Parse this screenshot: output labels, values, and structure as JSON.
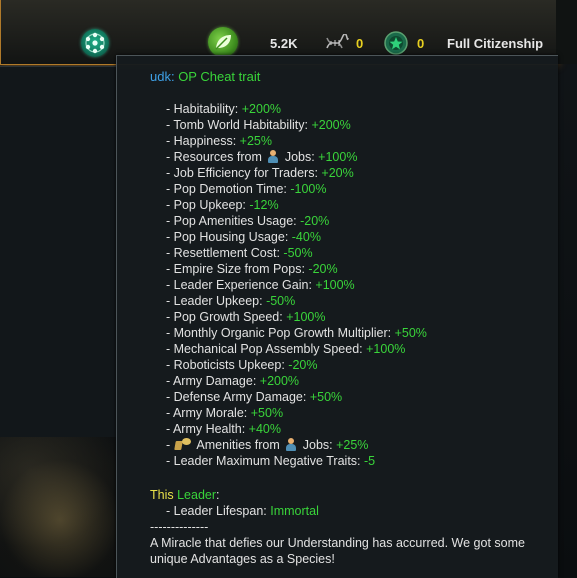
{
  "topbar": {
    "unity_icon": "unity-icon",
    "food_icon": "food-icon",
    "food_value": "5.2K",
    "dna_icon": "dna-icon",
    "dna_value": "0",
    "influence_icon": "influence-icon",
    "influence_value": "0",
    "citizenship_label": "Full Citizenship"
  },
  "tooltip": {
    "title_prefix": "udk: ",
    "title_name": "OP Cheat trait",
    "modifiers": [
      {
        "label": "- Habitability: ",
        "value": "+200%",
        "color": "#39d43a"
      },
      {
        "label": "- Tomb World Habitability: ",
        "value": "+200%",
        "color": "#39d43a"
      },
      {
        "label": "- Happiness: ",
        "value": "+25%",
        "color": "#39d43a"
      },
      {
        "label": "- Resources from ",
        "icon": "pop-icon",
        "label2": " Jobs: ",
        "value": "+100%",
        "color": "#39d43a"
      },
      {
        "label": "- Job Efficiency for Traders: ",
        "value": "+20%",
        "color": "#39d43a"
      },
      {
        "label": "- Pop Demotion Time: ",
        "value": "-100%",
        "color": "#39d43a"
      },
      {
        "label": "- Pop Upkeep: ",
        "value": "-12%",
        "color": "#39d43a"
      },
      {
        "label": "- Pop Amenities Usage: ",
        "value": "-20%",
        "color": "#39d43a"
      },
      {
        "label": "- Pop Housing Usage: ",
        "value": "-40%",
        "color": "#39d43a"
      },
      {
        "label": "- Resettlement Cost: ",
        "value": "-50%",
        "color": "#39d43a"
      },
      {
        "label": "- Empire Size from Pops: ",
        "value": "-20%",
        "color": "#39d43a"
      },
      {
        "label": "- Leader Experience Gain: ",
        "value": "+100%",
        "color": "#39d43a"
      },
      {
        "label": "- Leader Upkeep: ",
        "value": "-50%",
        "color": "#39d43a"
      },
      {
        "label": "- Pop Growth Speed: ",
        "value": "+100%",
        "color": "#39d43a"
      },
      {
        "label": "- Monthly Organic Pop Growth Multiplier: ",
        "value": "+50%",
        "color": "#39d43a"
      },
      {
        "label": "- Mechanical Pop Assembly Speed: ",
        "value": "+100%",
        "color": "#39d43a"
      },
      {
        "label": "- Roboticists Upkeep: ",
        "value": "-20%",
        "color": "#39d43a"
      },
      {
        "label": "- Army Damage: ",
        "value": "+200%",
        "color": "#39d43a"
      },
      {
        "label": "- Defense Army Damage: ",
        "value": "+50%",
        "color": "#39d43a"
      },
      {
        "label": "- Army Morale: ",
        "value": "+50%",
        "color": "#39d43a"
      },
      {
        "label": "- Army Health: ",
        "value": "+40%",
        "color": "#39d43a"
      },
      {
        "label": "- ",
        "icon": "amenities-icon",
        "label_mid": " Amenities from ",
        "icon2": "pop-icon",
        "label2": " Jobs: ",
        "value": "+25%",
        "color": "#39d43a"
      },
      {
        "label": "- Leader Maximum Negative Traits: ",
        "value": "-5",
        "color": "#39d43a"
      }
    ],
    "leader_this": "This",
    "leader_word": "Leader",
    "leader_colon": ":",
    "leader_lifespan_label": "- Leader Lifespan: ",
    "leader_lifespan_value": "Immortal",
    "separator": "--------------",
    "description": "A Miracle that defies our Understanding has accurred. We got some unique Advantages as a Species!"
  }
}
